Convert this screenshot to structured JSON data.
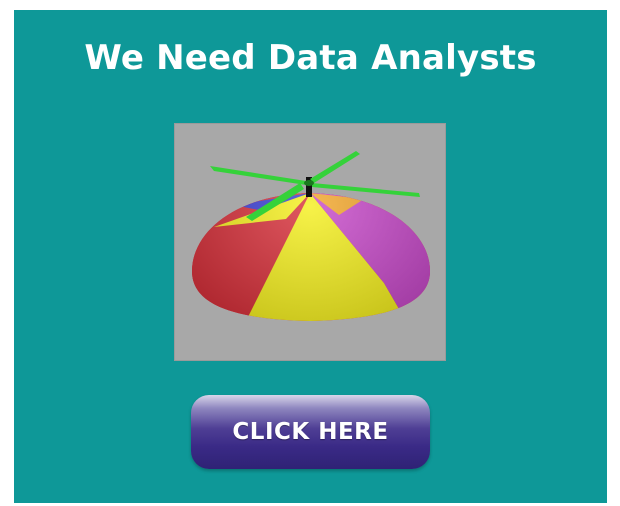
{
  "banner": {
    "background_color": "#0e9898",
    "headline": "We Need Data Analysts",
    "image": {
      "subject": "propeller-beanie-hat",
      "background_color": "#a8a8a8",
      "colors": {
        "red": "#d41f2a",
        "yellow": "#f4ee0c",
        "magenta": "#c43cc6",
        "blue": "#2a2fd0",
        "orange": "#f2a01a",
        "green": "#35d23a"
      }
    },
    "cta": {
      "label": "CLICK HERE",
      "color": "#3a2a86"
    }
  }
}
